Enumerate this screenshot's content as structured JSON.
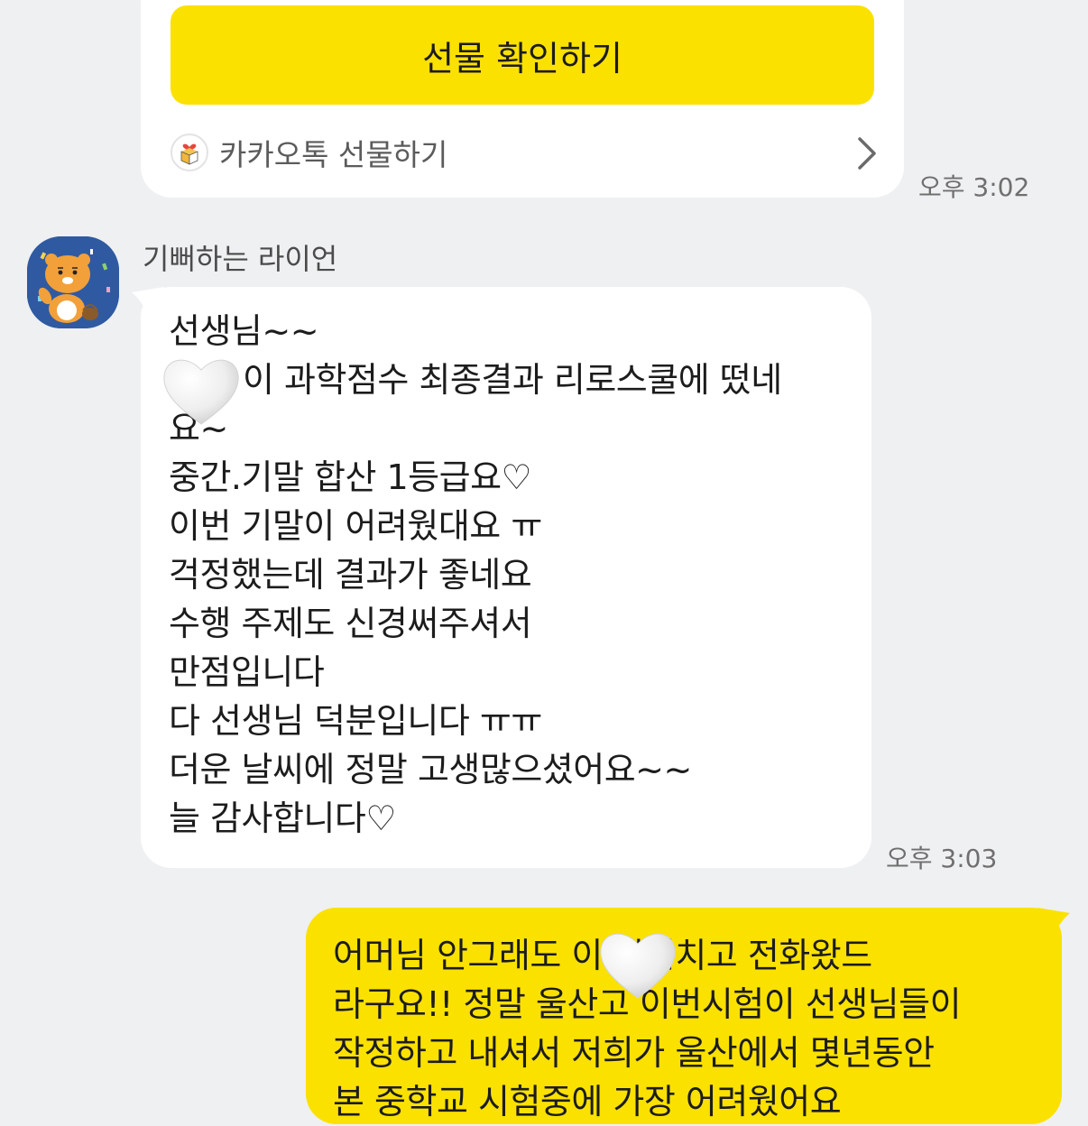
{
  "gift_card": {
    "button_label": "선물 확인하기",
    "footer_label": "카카오톡 선물하기",
    "footer_icon": "gift-box-icon",
    "chevron_icon": "chevron-right-icon",
    "time": "오후 3:02"
  },
  "received": {
    "sender_name": "기뻐하는 라이언",
    "avatar_icon": "ryan-character-avatar",
    "lines": [
      "선생님~~",
      "이 과학점수 최종결과 리로스쿨에 떴네",
      "요~",
      "중간.기말 합산 1등급요♡",
      "이번 기말이 어려웠대요 ㅠ",
      "걱정했는데 결과가 좋네요",
      "수행 주제도 신경써주셔서",
      "만점입니다",
      "다 선생님 덕분입니다  ㅠㅠ",
      "더운 날씨에 정말 고생많으셨어요~~",
      "늘 감사합니다♡"
    ],
    "time": "오후 3:03"
  },
  "sent": {
    "lines": [
      "어머님 안그래도 이 시험치고 전화왔드",
      "라구요!! 정말 울산고 이번시험이 선생님들이",
      "작정하고 내셔서 저희가 울산에서 몇년동안",
      "본 중학교 시험중에 가장 어려웠어요"
    ]
  },
  "colors": {
    "background": "#eff0f2",
    "kakao_yellow": "#fbe100",
    "bubble_white": "#ffffff"
  },
  "stickers": [
    "white-heart-icon",
    "white-heart-icon"
  ]
}
